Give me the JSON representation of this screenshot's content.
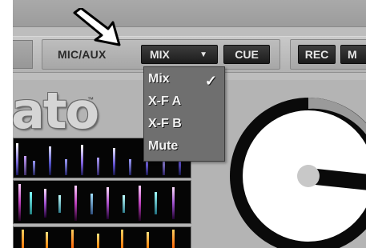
{
  "toolbar": {
    "mic_aux_label": "MIC/AUX",
    "mix_select_label": "MIX",
    "mix_select_arrow": "▼",
    "cue_label": "CUE",
    "rec_label": "REC",
    "m_label": "M"
  },
  "mix_dropdown": {
    "selected": "Mix",
    "items": [
      {
        "label": "Mix",
        "checked": true,
        "check_mark": "✓"
      },
      {
        "label": "X-F A",
        "checked": false
      },
      {
        "label": "X-F B",
        "checked": false
      },
      {
        "label": "Mute",
        "checked": false
      }
    ]
  },
  "logo": {
    "text": "ato",
    "tm": "™"
  },
  "icons": {
    "pointer": "arrow-pointer-icon",
    "dropdown_arrow": "triangle-down-icon",
    "check": "checkmark-icon"
  },
  "colors": {
    "background": "#b4b4b4",
    "button_dark": "#2a2a2a",
    "dropdown_bg": "#6f6f6f",
    "platter_ring": "#0a0a0a",
    "platter_face": "#ffffff",
    "platter_progress": "#9a9a9a"
  },
  "platter": {
    "played_fraction": 0.12
  }
}
